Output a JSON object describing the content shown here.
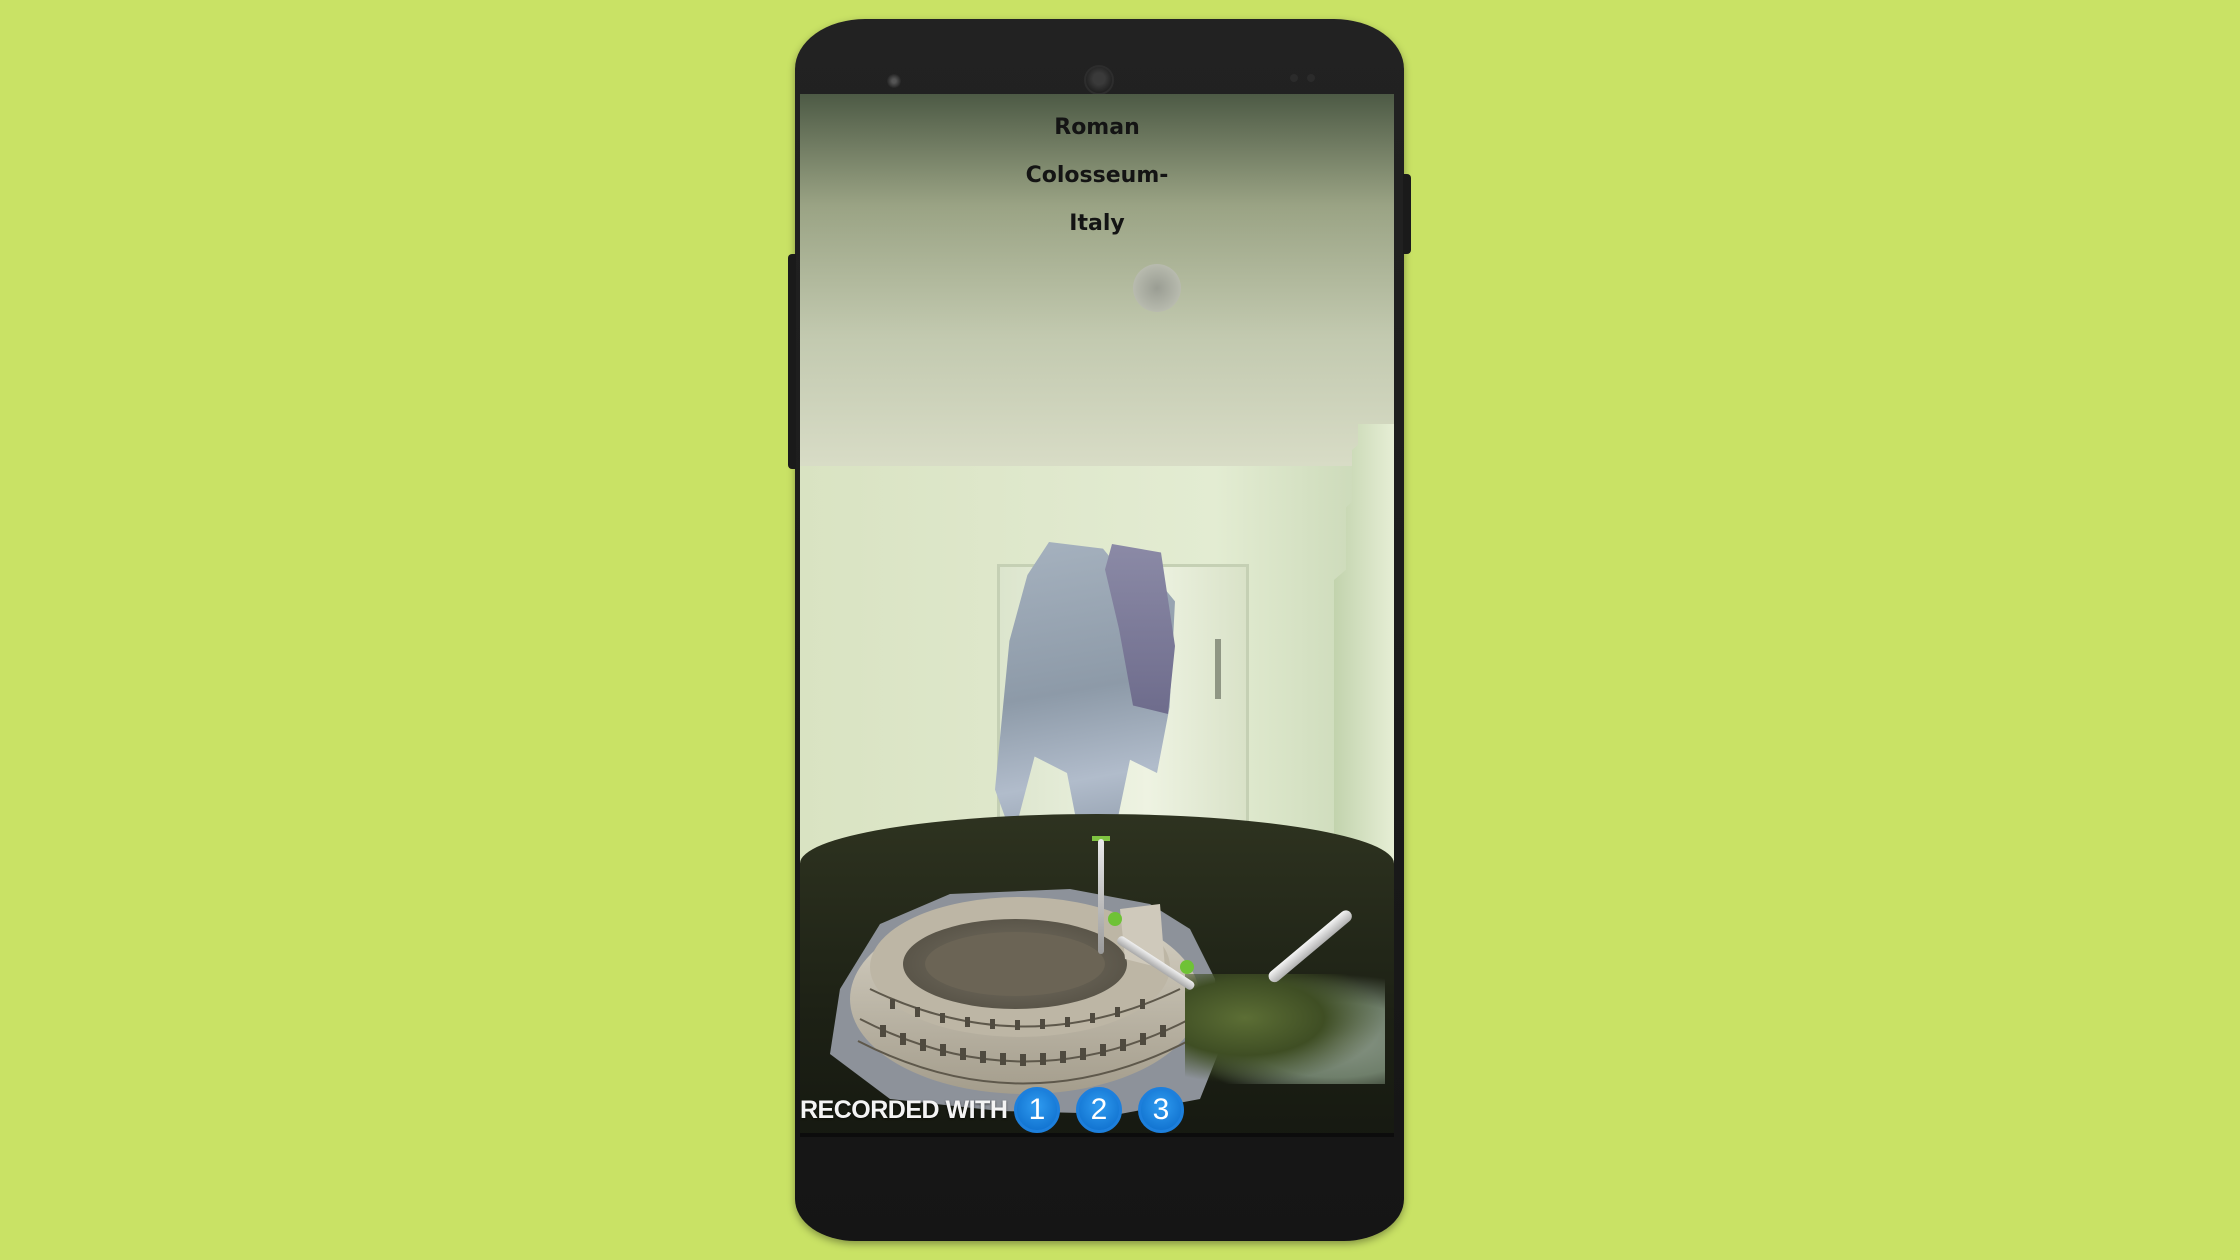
{
  "app": {
    "title_lines": [
      "Roman",
      "Colosseum-",
      "Italy"
    ]
  },
  "recording_bar": {
    "label": "RECORDED WITH",
    "badges": [
      "1",
      "2",
      "3"
    ],
    "badge_color": "#0a69c8"
  },
  "colors": {
    "background": "#c9e265",
    "phone_body": "#1a1a1a"
  },
  "icons": {
    "speaker": "speaker-grille-icon",
    "camera": "front-camera-icon"
  }
}
